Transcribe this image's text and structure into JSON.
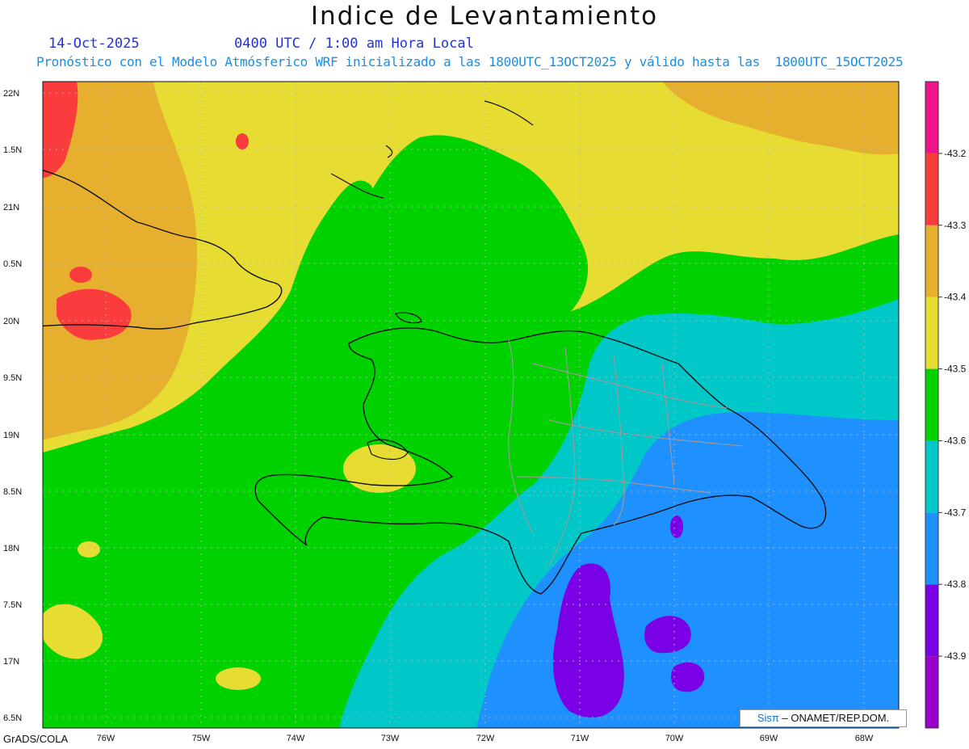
{
  "header": {
    "title": "Indice de Levantamiento",
    "date": "14-Oct-2025",
    "time": "0400 UTC / 1:00 am Hora Local",
    "model_line": "Pronóstico con el Modelo Atmósferico WRF inicializado a las 1800UTC_13OCT2025 y válido hasta las  1800UTC_15OCT2025"
  },
  "axes": {
    "lat_labels": [
      "22N",
      "1.5N",
      "21N",
      "0.5N",
      "20N",
      "9.5N",
      "19N",
      "8.5N",
      "18N",
      "7.5N",
      "17N",
      "6.5N"
    ],
    "lon_labels": [
      "76W",
      "75W",
      "74W",
      "73W",
      "72W",
      "71W",
      "70W",
      "69W",
      "68W"
    ]
  },
  "colorbar": {
    "colors": [
      "#9900cc",
      "#7a00e6",
      "#1e90ff",
      "#00c8c8",
      "#00d200",
      "#e6dc32",
      "#e6af2d",
      "#fa3c3c",
      "#f0148c"
    ],
    "labels": [
      "-43.9",
      "-43.8",
      "-43.7",
      "-43.6",
      "-43.5",
      "-43.4",
      "-43.3",
      "-43.2"
    ]
  },
  "footer": {
    "software": "GrADS/COLA",
    "credit_logo": "Sisπ",
    "credit_text": "– ONAMET/REP.DOM."
  }
}
